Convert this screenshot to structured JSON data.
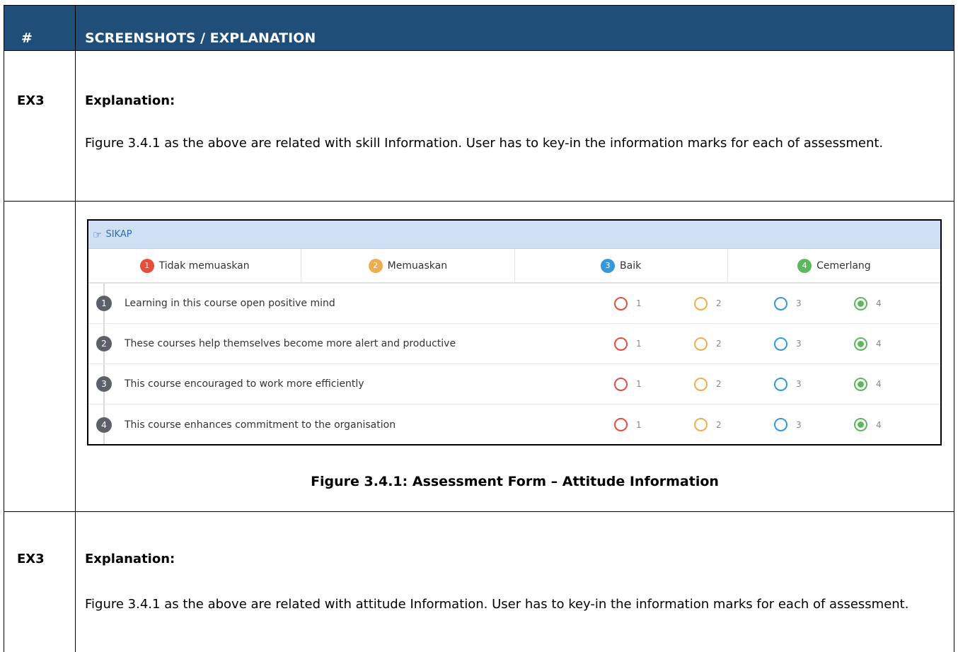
{
  "header": {
    "hash": "#",
    "title": "SCREENSHOTS / EXPLANATION"
  },
  "section1": {
    "id": "EX3",
    "title": "Explanation:",
    "body": "Figure 3.4.1 as the above are related with skill Information. User has to key-in the information marks for each of assessment."
  },
  "figure": {
    "panel_title": "SIKAP",
    "legend": [
      {
        "num": "1",
        "label": "Tidak memuaskan",
        "color": "#e74c3c"
      },
      {
        "num": "2",
        "label": "Memuaskan",
        "color": "#f0ad4e"
      },
      {
        "num": "3",
        "label": "Baik",
        "color": "#3498db"
      },
      {
        "num": "4",
        "label": "Cemerlang",
        "color": "#5cb85c"
      }
    ],
    "questions": [
      {
        "num": "1",
        "text": "Learning in this course open positive mind",
        "selected": 4
      },
      {
        "num": "2",
        "text": "These courses help themselves become more alert and productive",
        "selected": 4
      },
      {
        "num": "3",
        "text": "This course encouraged to work more efficiently",
        "selected": 4
      },
      {
        "num": "4",
        "text": "This course enhances commitment to the organisation",
        "selected": 4
      }
    ],
    "options": [
      "1",
      "2",
      "3",
      "4"
    ],
    "option_colors": [
      "#e74c3c",
      "#f0ad4e",
      "#3498db",
      "#5cb85c"
    ],
    "caption": "Figure 3.4.1: Assessment Form – Attitude Information"
  },
  "section2": {
    "id": "EX3",
    "title": "Explanation:",
    "body": "Figure 3.4.1 as the above are related with attitude Information. User has to key-in the information marks for each of assessment."
  }
}
